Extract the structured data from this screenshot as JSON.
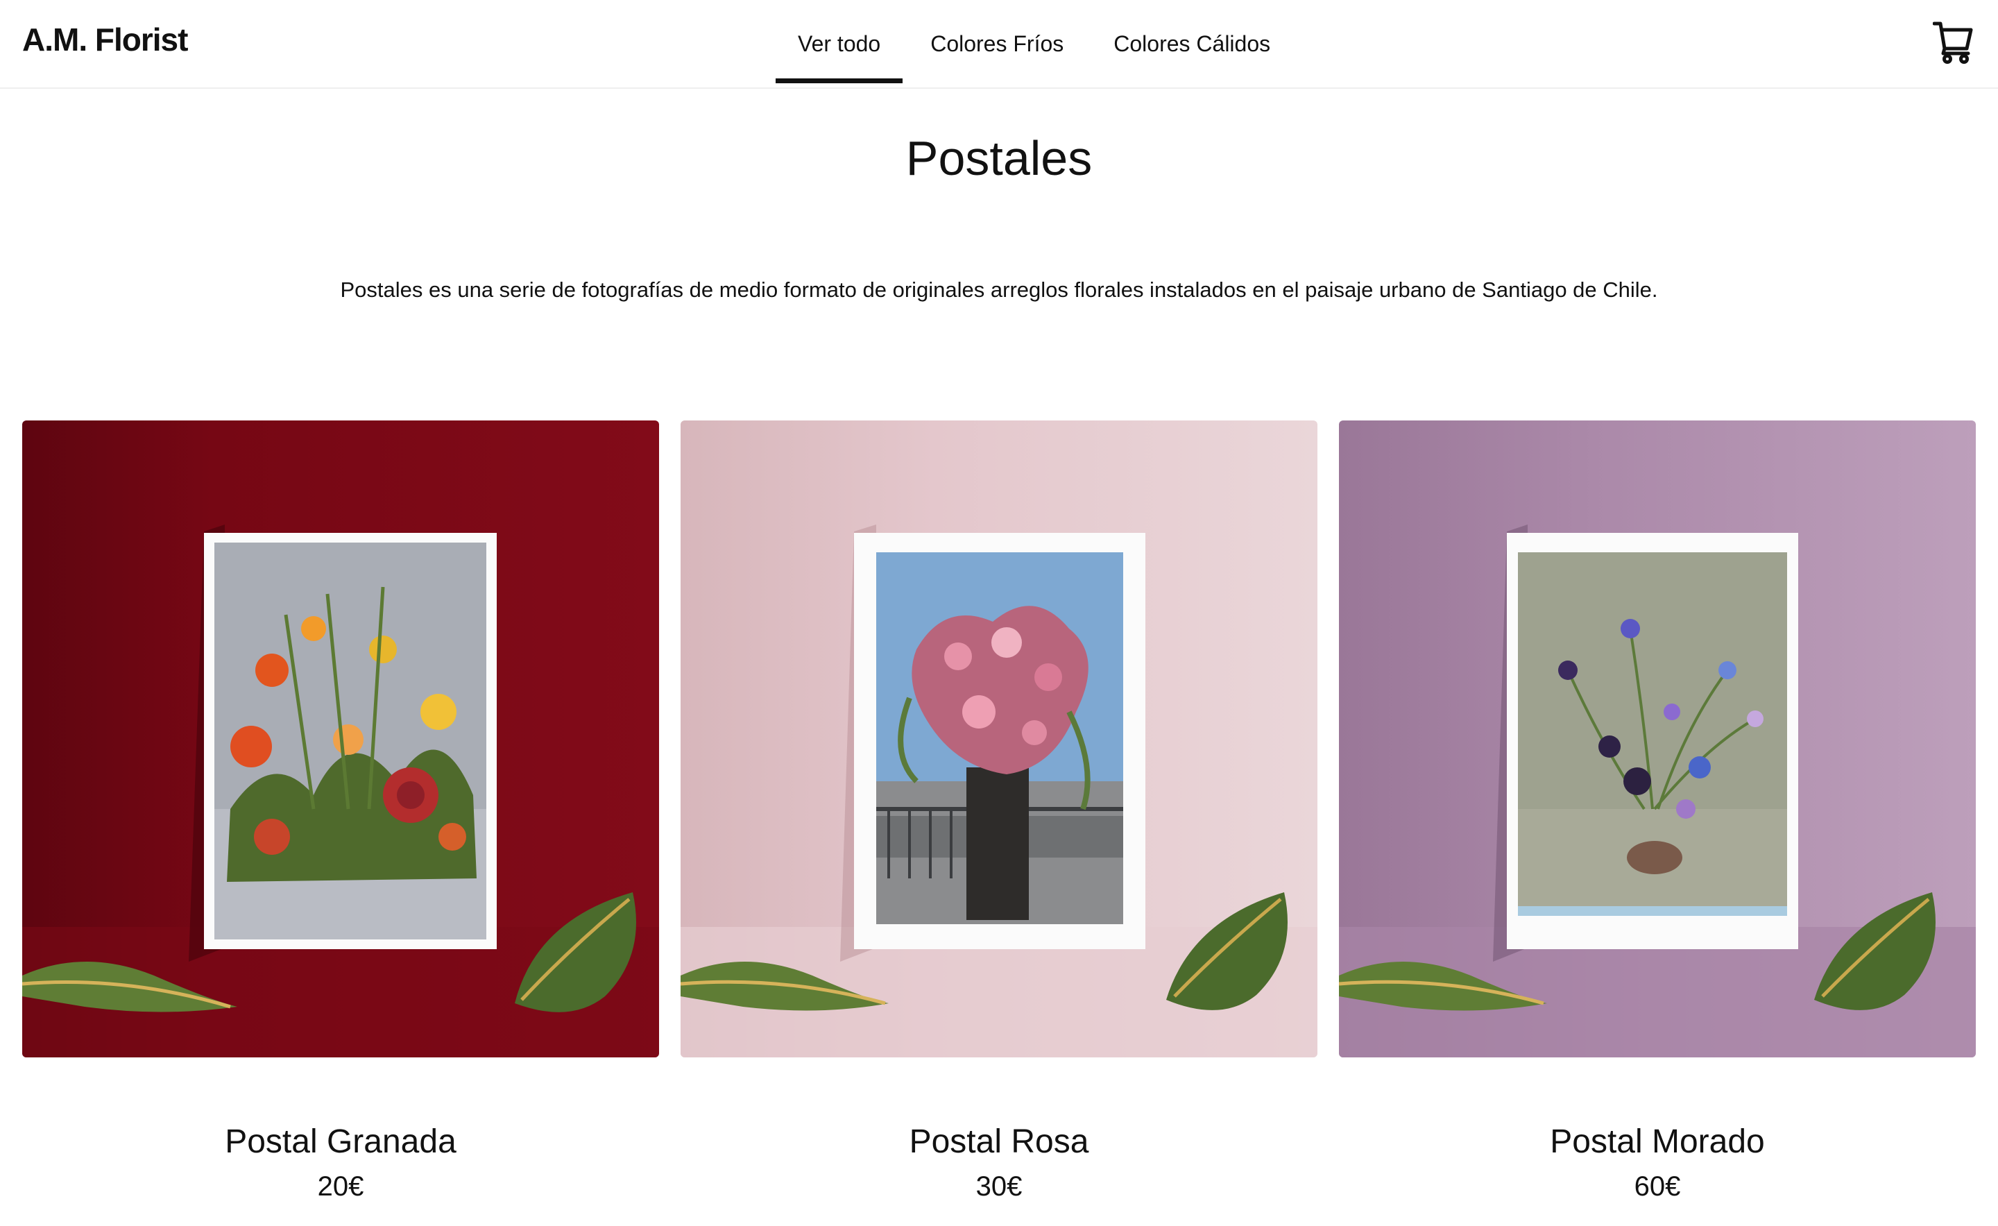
{
  "header": {
    "brand": "A.M. Florist",
    "nav": [
      {
        "label": "Ver todo",
        "active": true
      },
      {
        "label": "Colores Fríos",
        "active": false
      },
      {
        "label": "Colores Cálidos",
        "active": false
      }
    ],
    "cart_icon": "cart-icon"
  },
  "main": {
    "title": "Postales",
    "description": "Postales es una serie de fotografías de medio formato de originales arreglos florales instalados en el paisaje urbano de Santiago de Chile."
  },
  "products": [
    {
      "name": "Postal Granada",
      "price": "20€",
      "background": "#7d0a18"
    },
    {
      "name": "Postal Rosa",
      "price": "30€",
      "background": "#e5c9cd"
    },
    {
      "name": "Postal Morado",
      "price": "60€",
      "background": "#b18fb0"
    }
  ]
}
